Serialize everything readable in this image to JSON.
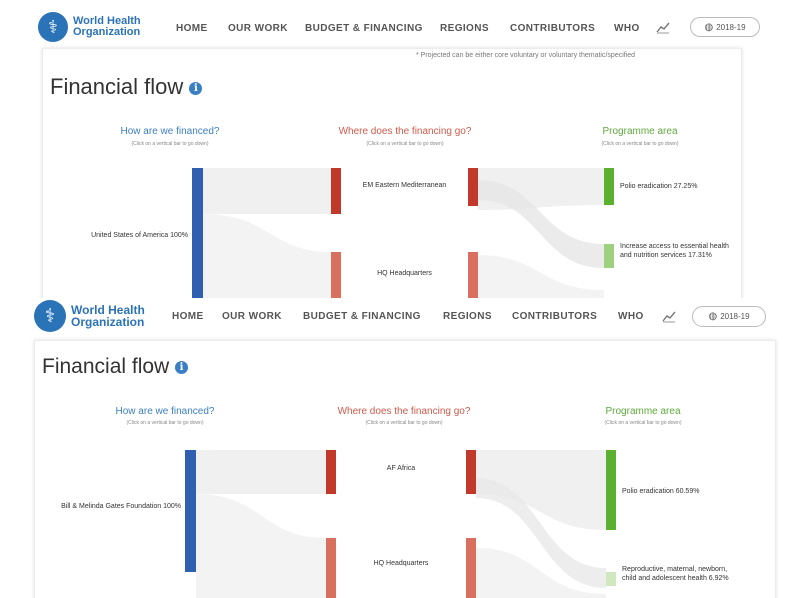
{
  "brand": {
    "logo_line1": "World Health",
    "logo_line2": "Organization",
    "emblem_glyph": "⚕"
  },
  "nav": {
    "items": [
      "HOME",
      "OUR WORK",
      "BUDGET & FINANCING",
      "REGIONS",
      "CONTRIBUTORS",
      "WHO"
    ],
    "chart_icon": "trend-chart-icon",
    "year": "2018-19",
    "year_icon": "globe-icon"
  },
  "page": {
    "note": "* Projected can be either core voluntary or voluntary thematic/specified",
    "title": "Financial flow",
    "info_glyph": "i"
  },
  "columns": {
    "source": "How are we financed?",
    "destination": "Where does the financing go?",
    "programme": "Programme area",
    "hint": "(Click on a vertical bar to go down)"
  },
  "colors": {
    "brand_blue": "#2b73b7",
    "source_bar": "#2f5fb0",
    "region_bar": "#c0392b",
    "hq_bar": "#d9705f",
    "programme_bar": "#5cb030",
    "programme_bar_light": "#9fd07f",
    "programme_bar_faint": "#cfe8c0"
  },
  "views": [
    {
      "source": "United States of America 100%",
      "regions": [
        "EM Eastern Mediterranean",
        "HQ Headquarters"
      ],
      "programmes": [
        "Polio eradication 27.25%",
        "Increase access to essential health and nutrition services 17.31%"
      ]
    },
    {
      "source": "Bill & Melinda Gates Foundation 100%",
      "regions": [
        "AF Africa",
        "HQ Headquarters"
      ],
      "programmes": [
        "Polio eradication 60.59%",
        "Reproductive, maternal, newborn, child and adolescent health 6.92%"
      ]
    }
  ]
}
